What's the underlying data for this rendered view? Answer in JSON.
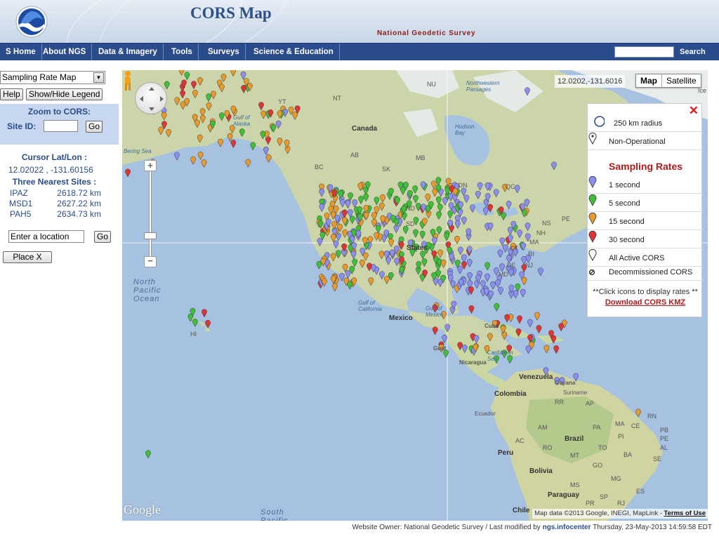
{
  "header": {
    "title": "CORS Map",
    "org_name": "National Geodetic Survey",
    "logo_icon": "noaa-logo-icon"
  },
  "nav": {
    "items": [
      "S Home",
      "About NGS",
      "Data & Imagery",
      "Tools",
      "Surveys",
      "Science & Education"
    ],
    "search_label": "Search",
    "search_placeholder": ""
  },
  "left_panel": {
    "map_select": "Sampling Rate Map",
    "help_label": "Help",
    "legend_toggle_label": "Show/Hide Legend",
    "zoom_title": "Zoom to CORS:",
    "site_id_label": "Site ID:",
    "go_label": "Go",
    "cursor_title": "Cursor Lat/Lon :",
    "cursor_value": "12.02022 , -131.60156",
    "nearest_title": "Three Nearest Sites :",
    "nearest": [
      {
        "name": "IPAZ",
        "dist": "2618.72 km"
      },
      {
        "name": "MSD1",
        "dist": "2627.22 km"
      },
      {
        "name": "PAH5",
        "dist": "2634.73 km"
      }
    ],
    "location_value": "Enter a location",
    "location_go_label": "Go",
    "place_x_label": "Place X"
  },
  "map": {
    "coord_readout": "12.0202,-131.6016",
    "map_type_map": "Map",
    "map_type_satellite": "Satellite",
    "google_logo": "Google",
    "attribution": "Map data ©2013 Google, INEGI, MapLink - ",
    "terms": "Terms of Use",
    "labels": {
      "canada": "Canada",
      "mexico": "Mexico",
      "venezuela": "Venezuela",
      "colombia": "Colombia",
      "ecuador": "Ecuador",
      "peru": "Peru",
      "brazil": "Brazil",
      "bolivia": "Bolivia",
      "paraguay": "Paraguay",
      "chile": "Chile",
      "guyana": "Guyana",
      "suriname": "Suriname",
      "nicaragua": "Nicaragua",
      "cuba": "Cuba",
      "guatemala": "Guat",
      "states": "States",
      "hudson_bay": "Hudson\nBay",
      "nw_passages": "Northwestern\nPassages",
      "nu": "NU",
      "nt": "NT",
      "yt": "YT",
      "bc": "BC",
      "ab": "AB",
      "sk": "SK",
      "mb": "MB",
      "on": "ON",
      "qc": "QC",
      "ns": "NS",
      "pe": "PE",
      "nh": "NH",
      "ma": "MA",
      "ct": "CT",
      "ri": "RI",
      "de": "DE",
      "nj": "NJ",
      "md": "MD",
      "nd": "ND",
      "sd": "SD",
      "hi": "HI",
      "gulf_alaska": "Gulf of\nAlaska",
      "gulf_california": "Gulf of\nCalifornia",
      "gulf_mexico": "Gulf of\nMexico",
      "caribbean": "Caribbean\nSea",
      "north_pacific": "North\nPacific\nOcean",
      "south_pacific": "South\nPacific",
      "bering": "Bering Sea",
      "ice": "Ice",
      "rr": "RR",
      "ap": "AP",
      "am": "AM",
      "pa": "PA",
      "ma_br": "MA",
      "pi": "PI",
      "ce": "CE",
      "rn": "RN",
      "pb": "PB",
      "pe_br": "PE",
      "al": "AL",
      "se": "SE",
      "ac": "AC",
      "ro": "RO",
      "to": "TO",
      "ba": "BA",
      "mt": "MT",
      "go": "GO",
      "mg": "MG",
      "es": "ES",
      "ms": "MS",
      "sp": "SP",
      "rj": "RJ",
      "pr": "PR"
    }
  },
  "legend": {
    "radius": "250 km radius",
    "non_operational": "Non-Operational",
    "heading": "Sampling Rates",
    "rates": [
      {
        "label": "1 second",
        "color": "#8b8ff0"
      },
      {
        "label": "5 second",
        "color": "#3fbf3a"
      },
      {
        "label": "15 second",
        "color": "#e89a2c"
      },
      {
        "label": "30 second",
        "color": "#e03535"
      }
    ],
    "all_active": "All Active CORS",
    "decommissioned": "Decommissioned CORS",
    "note": "**Click icons to display rates **",
    "kmz_link": "Download CORS KMZ",
    "close_icon": "close-icon"
  },
  "footer": {
    "prefix": "Website Owner: National Geodetic Survey  /  Last modified by ",
    "link": "ngs.infocenter",
    "suffix": " Thursday, 23-May-2013 14:59:58 EDT"
  },
  "colors": {
    "nav_bg": "#2b4c8c",
    "ocean": "#a6c2e0",
    "land": "#c9d3a8",
    "marker_blue": "#8b8ff0",
    "marker_green": "#3fbf3a",
    "marker_orange": "#e89a2c",
    "marker_red": "#e03535"
  }
}
